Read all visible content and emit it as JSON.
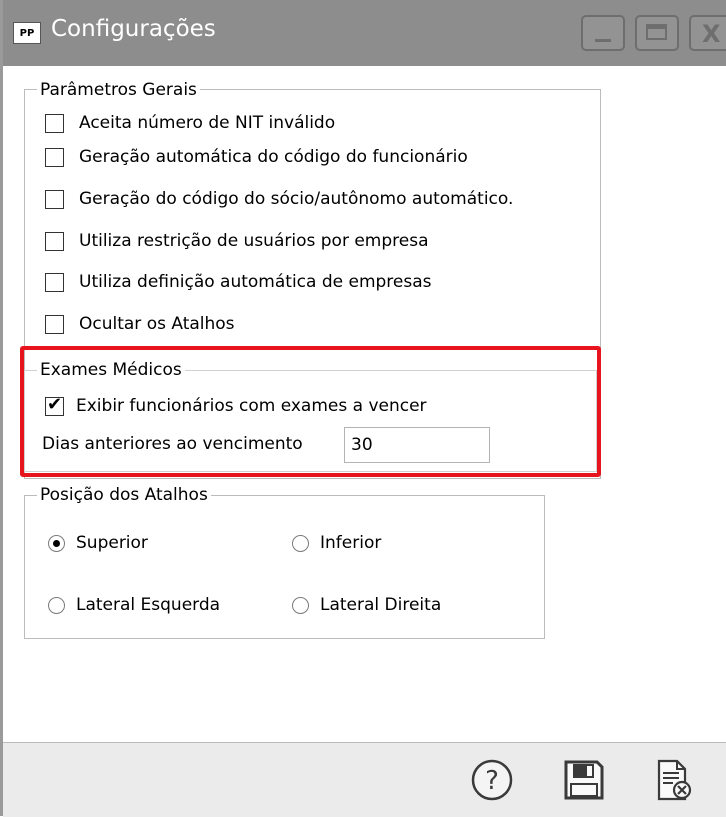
{
  "window": {
    "title": "Configurações",
    "app_icon_text": "PP"
  },
  "parametros_gerais": {
    "title": "Parâmetros Gerais",
    "options": [
      {
        "label": "Aceita número de NIT inválido",
        "checked": false
      },
      {
        "label": "Geração automática do código do funcionário",
        "checked": false
      },
      {
        "label": "Geração do código do sócio/autônomo automático.",
        "checked": false
      },
      {
        "label": "Utiliza restrição de usuários por empresa",
        "checked": false
      },
      {
        "label": "Utiliza definição automática de empresas",
        "checked": false
      },
      {
        "label": "Ocultar os Atalhos",
        "checked": false
      }
    ]
  },
  "exames_medicos": {
    "title": "Exames Médicos",
    "exibir_label": "Exibir funcionários com exames a vencer",
    "exibir_checked": true,
    "dias_label": "Dias anteriores ao vencimento",
    "dias_value": "30"
  },
  "posicao_atalhos": {
    "title": "Posição dos Atalhos",
    "options": [
      {
        "label": "Superior",
        "selected": true
      },
      {
        "label": "Inferior",
        "selected": false
      },
      {
        "label": "Lateral Esquerda",
        "selected": false
      },
      {
        "label": "Lateral Direita",
        "selected": false
      }
    ]
  },
  "footer": {
    "buttons": [
      "help-icon",
      "save-icon",
      "close-document-icon"
    ]
  },
  "colors": {
    "titlebar": "#8d8d8d",
    "highlight": "#e8141d",
    "footer": "#ebebeb"
  }
}
